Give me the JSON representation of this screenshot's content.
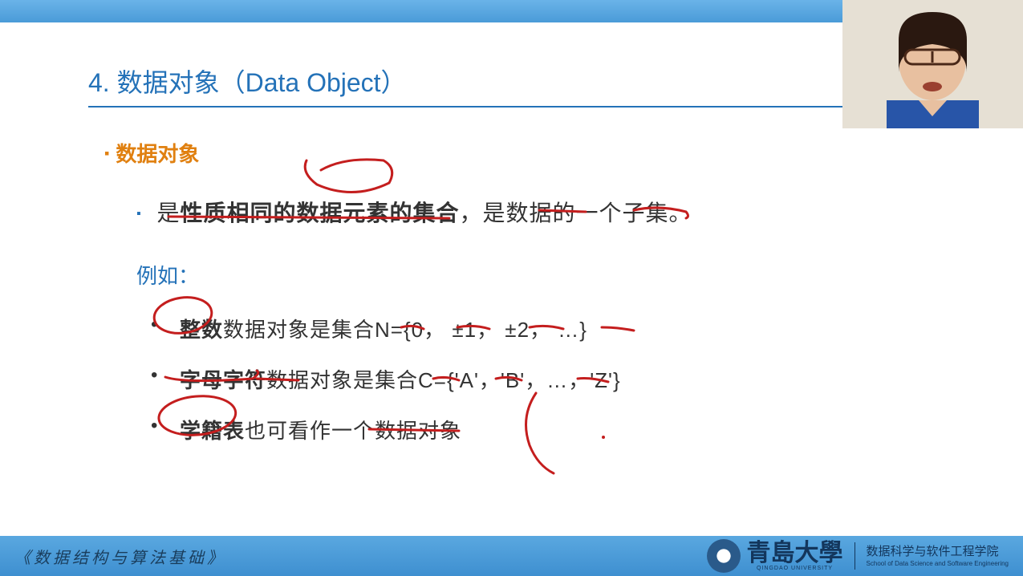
{
  "slide": {
    "title": "4. 数据对象（Data Object）",
    "section_header": "数据对象",
    "definition_prefix": "是",
    "definition_bold": "性质相同的数据元素的集合",
    "definition_suffix": "，是数据的一个子集。",
    "example_label": "例如：",
    "examples": [
      {
        "bold": "整数",
        "rest": "数据对象是集合N={0，  ±1，  ±2，  …}"
      },
      {
        "bold": "字母字符",
        "rest": "数据对象是集合C={'A'，'B'，…，'Z'}"
      },
      {
        "bold": "学籍表",
        "rest": "也可看作一个数据对象"
      }
    ]
  },
  "footer": {
    "course_title": "《数据结构与算法基础》",
    "university_cn": "青島大學",
    "university_en": "QINGDAO UNIVERSITY",
    "school_cn": "数据科学与软件工程学院",
    "school_en": "School of Data Science and Software Engineering"
  }
}
